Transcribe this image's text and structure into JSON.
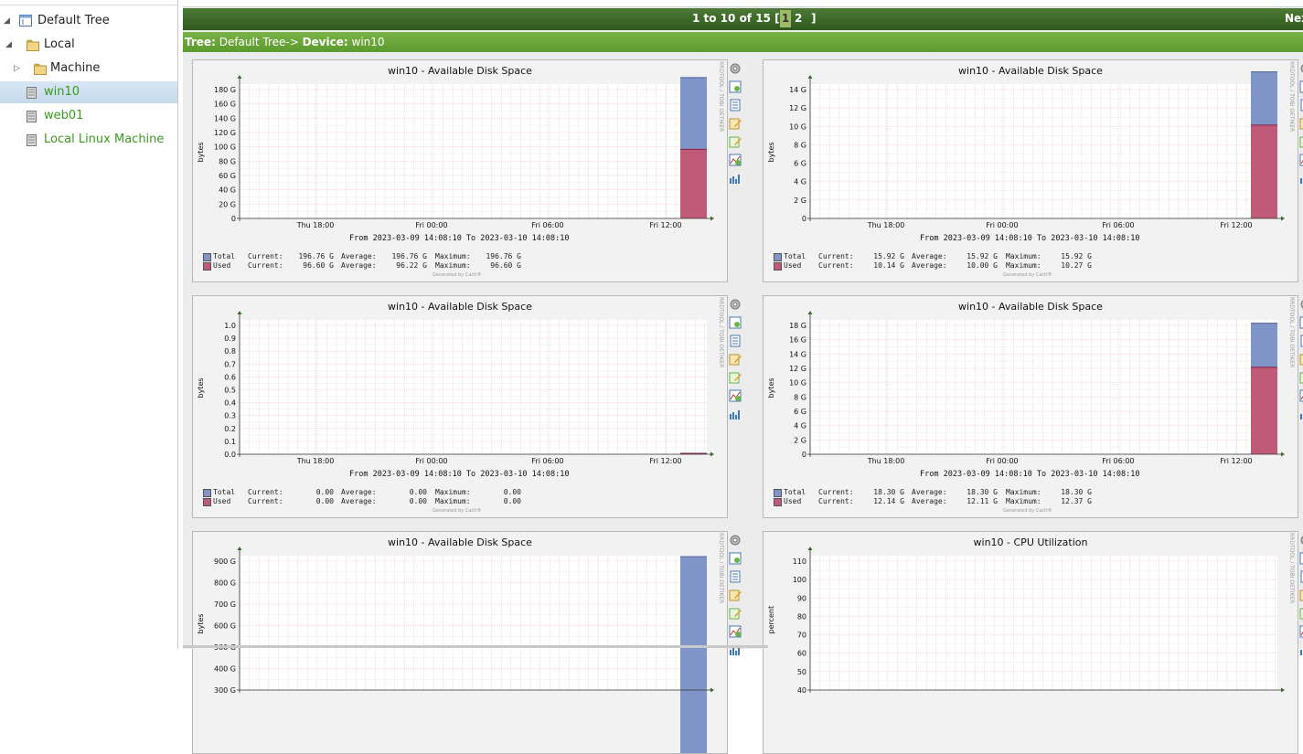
{
  "sidebar": {
    "nodes": [
      {
        "label": "Default Tree",
        "icon": "tree-root-icon",
        "expanded": true
      },
      {
        "label": "Local",
        "icon": "folder-icon",
        "expanded": true
      },
      {
        "label": "Machine",
        "icon": "folder-icon",
        "expanded": false
      },
      {
        "label": "win10",
        "icon": "device-icon",
        "selected": true
      },
      {
        "label": "web01",
        "icon": "device-icon"
      },
      {
        "label": "Local Linux Machine",
        "icon": "device-icon"
      }
    ]
  },
  "navbar": {
    "range": "1 to 10 of 15 [",
    "page1": "1",
    "page2": "2",
    "close": "]",
    "next": "Nex"
  },
  "treebar": {
    "tree_label": "Tree:",
    "tree_value": "Default Tree->",
    "device_label": "Device:",
    "device_value": "win10"
  },
  "colors": {
    "total": "#7f94c9",
    "used": "#c05a79",
    "nav_dark": "#2e5a1c",
    "tree_bar": "#6aa63a",
    "tree_link": "#3a9a1e"
  },
  "graphs": [
    {
      "title": "win10 - Available Disk Space",
      "ylabel": "bytes",
      "yticks": [
        "0",
        "20 G",
        "40 G",
        "60 G",
        "80 G",
        "100 G",
        "120 G",
        "140 G",
        "160 G",
        "180 G"
      ],
      "xticks": [
        "Thu 18:00",
        "Fri 00:00",
        "Fri 06:00",
        "Fri 12:00"
      ],
      "range": "From 2023-03-09 14:08:10 To 2023-03-10 14:08:10",
      "rows": [
        {
          "name": "Total",
          "current": "196.76 G",
          "average": "196.76 G",
          "maximum": "196.76 G"
        },
        {
          "name": "Used",
          "current": "96.60 G",
          "average": "96.22 G",
          "maximum": "96.60 G"
        }
      ],
      "generated": "Generated by Cacti®",
      "side": "RRDTOOL / TOBI OETIKER"
    },
    {
      "title": "win10 - Available Disk Space",
      "ylabel": "bytes",
      "yticks": [
        "0",
        "2 G",
        "4 G",
        "6 G",
        "8 G",
        "10 G",
        "12 G",
        "14 G"
      ],
      "xticks": [
        "Thu 18:00",
        "Fri 00:00",
        "Fri 06:00",
        "Fri 12:00"
      ],
      "range": "From 2023-03-09 14:08:10 To 2023-03-10 14:08:10",
      "rows": [
        {
          "name": "Total",
          "current": "15.92 G",
          "average": "15.92 G",
          "maximum": "15.92 G"
        },
        {
          "name": "Used",
          "current": "10.14 G",
          "average": "10.00 G",
          "maximum": "10.27 G"
        }
      ],
      "generated": "Generated by Cacti®",
      "side": "RRDTOOL / TOBI OETIKER"
    },
    {
      "title": "win10 - Available Disk Space",
      "ylabel": "bytes",
      "yticks": [
        "0.0",
        "0.1",
        "0.2",
        "0.3",
        "0.4",
        "0.5",
        "0.6",
        "0.7",
        "0.8",
        "0.9",
        "1.0"
      ],
      "xticks": [
        "Thu 18:00",
        "Fri 00:00",
        "Fri 06:00",
        "Fri 12:00"
      ],
      "range": "From 2023-03-09 14:08:10 To 2023-03-10 14:08:10",
      "rows": [
        {
          "name": "Total",
          "current": "0.00",
          "average": "0.00",
          "maximum": "0.00"
        },
        {
          "name": "Used",
          "current": "0.00",
          "average": "0.00",
          "maximum": "0.00"
        }
      ],
      "generated": "Generated by Cacti®",
      "side": "RRDTOOL / TOBI OETIKER"
    },
    {
      "title": "win10 - Available Disk Space",
      "ylabel": "bytes",
      "yticks": [
        "0",
        "2 G",
        "4 G",
        "6 G",
        "8 G",
        "10 G",
        "12 G",
        "14 G",
        "16 G",
        "18 G"
      ],
      "xticks": [
        "Thu 18:00",
        "Fri 00:00",
        "Fri 06:00",
        "Fri 12:00"
      ],
      "range": "From 2023-03-09 14:08:10 To 2023-03-10 14:08:10",
      "rows": [
        {
          "name": "Total",
          "current": "18.30 G",
          "average": "18.30 G",
          "maximum": "18.30 G"
        },
        {
          "name": "Used",
          "current": "12.14 G",
          "average": "12.11 G",
          "maximum": "12.37 G"
        }
      ],
      "generated": "Generated by Cacti®",
      "side": "RRDTOOL / TOBI OETIKER"
    },
    {
      "title": "win10 - Available Disk Space",
      "ylabel": "bytes",
      "yticks": [
        "300 G",
        "400 G",
        "500 G",
        "600 G",
        "700 G",
        "800 G",
        "900 G"
      ],
      "xticks": [],
      "range": "",
      "rows": [],
      "generated": "",
      "side": "RRDTOOL / TOBI OETIKER"
    },
    {
      "title": "win10 - CPU Utilization",
      "ylabel": "percent",
      "yticks": [
        "40",
        "50",
        "60",
        "70",
        "80",
        "90",
        "100",
        "110"
      ],
      "xticks": [],
      "range": "",
      "rows": [],
      "generated": "",
      "side": "RRDTOOL / TOBI OETIKER"
    }
  ],
  "chart_data": [
    {
      "type": "area",
      "title": "win10 - Available Disk Space",
      "ylabel": "bytes",
      "ylim": [
        0,
        196.76
      ],
      "unit": "G",
      "series": [
        {
          "name": "Total",
          "values": [
            196.76
          ]
        },
        {
          "name": "Used",
          "values": [
            96.6
          ]
        }
      ]
    },
    {
      "type": "area",
      "title": "win10 - Available Disk Space",
      "ylabel": "bytes",
      "ylim": [
        0,
        15.92
      ],
      "unit": "G",
      "series": [
        {
          "name": "Total",
          "values": [
            15.92
          ]
        },
        {
          "name": "Used",
          "values": [
            10.14
          ]
        }
      ]
    },
    {
      "type": "area",
      "title": "win10 - Available Disk Space",
      "ylabel": "bytes",
      "ylim": [
        0,
        1.0
      ],
      "series": [
        {
          "name": "Total",
          "values": [
            0.0
          ]
        },
        {
          "name": "Used",
          "values": [
            0.0
          ]
        }
      ]
    },
    {
      "type": "area",
      "title": "win10 - Available Disk Space",
      "ylabel": "bytes",
      "ylim": [
        0,
        18.3
      ],
      "unit": "G",
      "series": [
        {
          "name": "Total",
          "values": [
            18.3
          ]
        },
        {
          "name": "Used",
          "values": [
            12.14
          ]
        }
      ]
    },
    {
      "type": "area",
      "title": "win10 - Available Disk Space",
      "ylabel": "bytes",
      "unit": "G"
    },
    {
      "type": "line",
      "title": "win10 - CPU Utilization",
      "ylabel": "percent"
    }
  ]
}
